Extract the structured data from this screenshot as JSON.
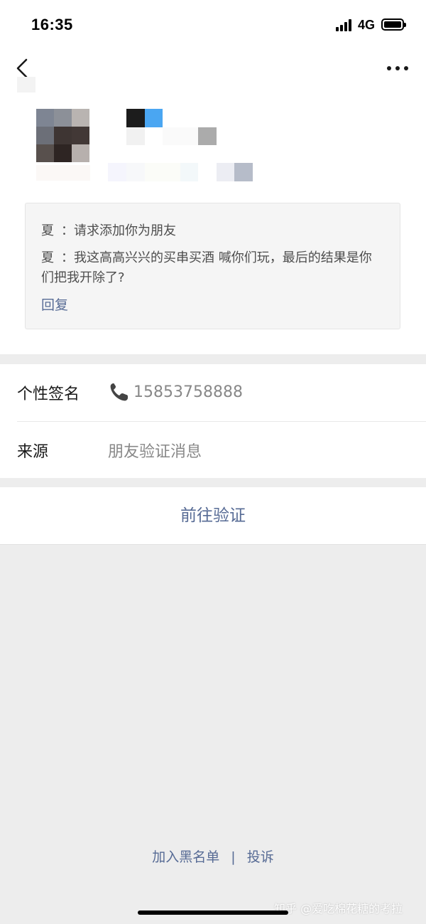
{
  "status_bar": {
    "time": "16:35",
    "network": "4G"
  },
  "nav": {
    "back_icon": "chevron-left-icon",
    "more_icon": "more-dots-icon"
  },
  "request": {
    "messages": [
      {
        "sender": "夏",
        "text": "：请求添加你为朋友"
      },
      {
        "sender": "夏",
        "text": "：我这高高兴兴的买串买酒 喊你们玩，最后的结果是你们把我开除了?"
      }
    ],
    "reply_label": "回复"
  },
  "profile_rows": [
    {
      "label": "个性签名",
      "value": "15853758888",
      "icon": "phone-icon"
    },
    {
      "label": "来源",
      "value": "朋友验证消息"
    }
  ],
  "verify_button": "前往验证",
  "footer": {
    "blacklist": "加入黑名单",
    "separator": "|",
    "report": "投诉"
  },
  "watermark": "知乎 @爱吃棉花糖的考拉",
  "colors": {
    "link": "#576b95",
    "background": "#ededed",
    "card": "#ffffff"
  }
}
